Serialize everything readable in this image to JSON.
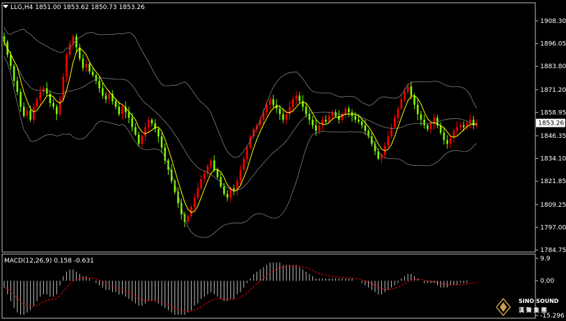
{
  "symbol_header": {
    "symbol": "LLG,H4",
    "open": "1851.00",
    "high": "1853.62",
    "low": "1850.73",
    "close": "1853.26"
  },
  "price_axis": {
    "ticks": [
      "1908.30",
      "1896.05",
      "1883.80",
      "1871.20",
      "1858.95",
      "1846.35",
      "1834.10",
      "1821.85",
      "1809.25",
      "1797.00",
      "1784.75"
    ],
    "current_price": "1853.26"
  },
  "macd": {
    "label": "MACD(12,26,9) 0.158 -0.631",
    "axis_ticks": [
      "9.9",
      "0.00",
      "-15.296"
    ]
  },
  "logo": {
    "line1": "SINO SOUND",
    "line2": "漢 聲 集 團"
  },
  "colors": {
    "background": "#000000",
    "bull": "#ff0000",
    "bear": "#7cfc00",
    "ma": "#ffff00",
    "bands": "#808080",
    "macd_hist": "#c0c0c0",
    "signal": "#ff0000",
    "axis": "#c0c0c0"
  },
  "chart_data": {
    "type": "candlestick",
    "timeframe": "H4",
    "ylim": [
      1784.75,
      1908.3
    ],
    "closes": [
      1897,
      1890,
      1884,
      1876,
      1870,
      1862,
      1857,
      1860,
      1855,
      1862,
      1866,
      1870,
      1872,
      1869,
      1864,
      1862,
      1858,
      1866,
      1878,
      1890,
      1896,
      1900,
      1894,
      1888,
      1883,
      1885,
      1881,
      1879,
      1876,
      1872,
      1868,
      1866,
      1869,
      1865,
      1862,
      1858,
      1862,
      1859,
      1856,
      1851,
      1847,
      1842,
      1846,
      1851,
      1855,
      1853,
      1850,
      1846,
      1840,
      1833,
      1828,
      1822,
      1816,
      1810,
      1804,
      1800,
      1803,
      1808,
      1813,
      1818,
      1823,
      1826,
      1830,
      1833,
      1828,
      1824,
      1819,
      1815,
      1813,
      1818,
      1817,
      1822,
      1828,
      1834,
      1840,
      1846,
      1850,
      1852,
      1855,
      1859,
      1863,
      1866,
      1863,
      1861,
      1858,
      1855,
      1858,
      1862,
      1866,
      1868,
      1865,
      1862,
      1858,
      1855,
      1852,
      1849,
      1852,
      1855,
      1854,
      1857,
      1859,
      1857,
      1855,
      1858,
      1861,
      1859,
      1857,
      1855,
      1854,
      1852,
      1849,
      1846,
      1842,
      1838,
      1834,
      1836,
      1841,
      1846,
      1851,
      1856,
      1861,
      1866,
      1870,
      1873,
      1868,
      1863,
      1858,
      1855,
      1852,
      1850,
      1853,
      1856,
      1852,
      1848,
      1844,
      1842,
      1845,
      1849,
      1851,
      1852,
      1851,
      1853,
      1855,
      1852,
      1853
    ],
    "macd": [
      -3,
      -6,
      -9,
      -12,
      -14,
      -15,
      -15,
      -14,
      -13,
      -11,
      -9,
      -7,
      -6,
      -6,
      -7,
      -7,
      -6,
      -2,
      2,
      4,
      5,
      5,
      4,
      3,
      2,
      2,
      1,
      0,
      -1,
      -2,
      -3,
      -4,
      -4,
      -5,
      -5,
      -6,
      -6,
      -7,
      -8,
      -9,
      -10,
      -11,
      -11,
      -10,
      -9,
      -9,
      -9,
      -10,
      -11,
      -12,
      -13,
      -14,
      -15,
      -15,
      -15,
      -15,
      -14,
      -13,
      -11,
      -10,
      -8,
      -7,
      -6,
      -5,
      -6,
      -7,
      -8,
      -9,
      -9,
      -8,
      -8,
      -6,
      -5,
      -3,
      -1,
      1,
      3,
      4,
      5,
      6,
      7,
      8,
      8,
      8,
      8,
      7,
      7,
      7,
      7,
      7,
      6,
      5,
      4,
      3,
      2,
      1,
      1,
      1,
      1,
      1,
      1,
      1,
      1,
      1,
      1,
      1,
      1,
      0,
      0,
      -1,
      -2,
      -3,
      -4,
      -5,
      -6,
      -6,
      -5,
      -4,
      -3,
      -2,
      -1,
      1,
      2,
      3,
      3,
      2,
      1,
      0,
      -1,
      -1,
      -1,
      -1,
      -2,
      -3,
      -3,
      -3,
      -2,
      -2,
      -2,
      -1,
      -1,
      -1,
      0,
      0,
      0
    ]
  }
}
